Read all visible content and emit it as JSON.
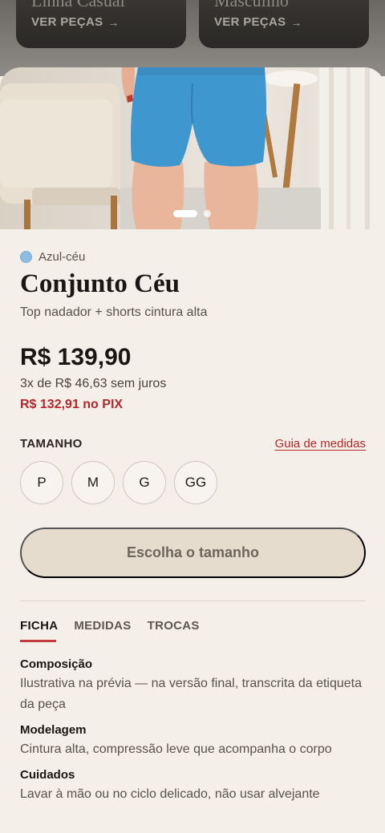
{
  "categories": [
    {
      "title": "Linha Casual",
      "link": "VER PEÇAS",
      "arrow": "→"
    },
    {
      "title": "Masculino",
      "link": "VER PEÇAS",
      "arrow": "→"
    }
  ],
  "carousel": {
    "slides": 2,
    "active": 1
  },
  "product": {
    "color_name": "Azul-céu",
    "color_hex": "#8ebde3",
    "title": "Conjunto Céu",
    "subtitle": "Top nadador + shorts cintura alta",
    "price": "R$ 139,90",
    "installments": "3x de R$ 46,63 sem juros",
    "pix_price": "R$ 132,91 no PIX"
  },
  "size": {
    "label": "TAMANHO",
    "guide_link": "Guia de medidas",
    "options": [
      "P",
      "M",
      "G",
      "GG"
    ]
  },
  "cta": {
    "label": "Escolha o tamanho"
  },
  "tabs": [
    {
      "label": "FICHA",
      "active": true
    },
    {
      "label": "MEDIDAS",
      "active": false
    },
    {
      "label": "TROCAS",
      "active": false
    }
  ],
  "specs": [
    {
      "title": "Composição",
      "text": "Ilustrativa na prévia — na versão final, transcrita da etiqueta da peça"
    },
    {
      "title": "Modelagem",
      "text": "Cintura alta, compressão leve que acompanha o corpo"
    },
    {
      "title": "Cuidados",
      "text": "Lavar à mão ou no ciclo delicado, não usar alvejante"
    }
  ],
  "colors": {
    "accent": "#b3262a",
    "background": "#f4efe8",
    "cta_bg": "#e6dccd"
  }
}
